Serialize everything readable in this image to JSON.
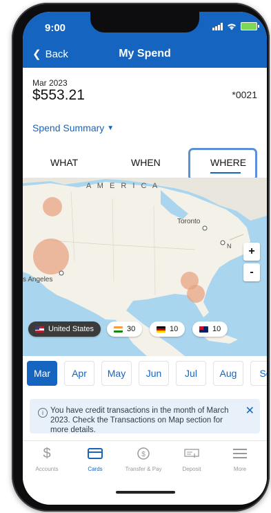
{
  "status": {
    "time": "9:00"
  },
  "header": {
    "back_label": "Back",
    "title": "My Spend"
  },
  "summary": {
    "period": "Mar 2023",
    "amount": "$553.21",
    "account": "*0021"
  },
  "spend_summary_label": "Spend Summary",
  "tabs": [
    {
      "label": "WHAT"
    },
    {
      "label": "WHEN"
    },
    {
      "label": "WHERE",
      "selected": true
    }
  ],
  "map": {
    "labels": {
      "america": "A M E R I C A",
      "toronto": "Toronto",
      "los_angeles": "s Angeles",
      "ny": "N"
    },
    "zoom_in": "+",
    "zoom_out": "-"
  },
  "country_chips": [
    {
      "label": "United States",
      "active": true
    },
    {
      "count": "30"
    },
    {
      "count": "10"
    },
    {
      "count": "10"
    }
  ],
  "months": [
    {
      "label": "Mar",
      "active": true
    },
    {
      "label": "Apr"
    },
    {
      "label": "May"
    },
    {
      "label": "Jun"
    },
    {
      "label": "Jul"
    },
    {
      "label": "Aug"
    },
    {
      "label": "Se"
    }
  ],
  "notice": {
    "text": "You have credit transactions in the month of March 2023. Check the Transactions on Map section for more details."
  },
  "bottom_nav": [
    {
      "label": "Accounts",
      "icon": "dollar-icon"
    },
    {
      "label": "Cards",
      "icon": "card-icon",
      "active": true
    },
    {
      "label": "Transfer & Pay",
      "icon": "transfer-icon"
    },
    {
      "label": "Deposit",
      "icon": "check-deposit-icon"
    },
    {
      "label": "More",
      "icon": "menu-icon"
    }
  ],
  "colors": {
    "primary": "#1565c0",
    "highlight_box": "#5b8fd6",
    "bubble": "#e8a07e",
    "notice_bg": "#e8f1fa"
  }
}
